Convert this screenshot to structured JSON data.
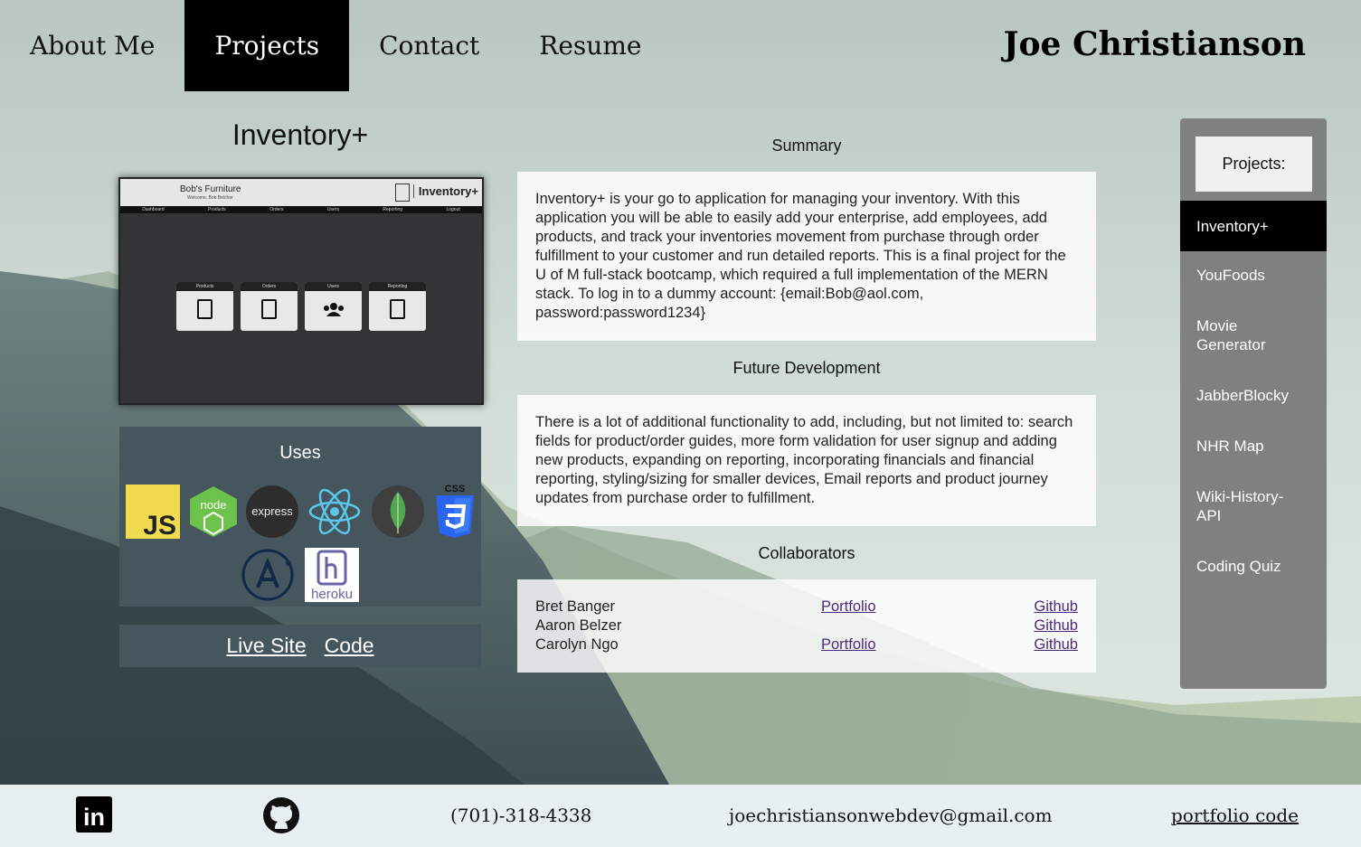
{
  "nav": {
    "items": [
      {
        "label": "About Me",
        "active": false
      },
      {
        "label": "Projects",
        "active": true
      },
      {
        "label": "Contact",
        "active": false
      },
      {
        "label": "Resume",
        "active": false
      }
    ],
    "site_title": "Joe Christianson"
  },
  "project": {
    "title": "Inventory+",
    "screenshot": {
      "company": "Bob's Furniture",
      "welcome": "Welcome, Bob Belcher",
      "brand": "Inventory+",
      "menu": [
        "Dashboard",
        "Products",
        "Orders",
        "Users",
        "Reporting",
        "Logout"
      ],
      "cards": [
        "Products",
        "Orders",
        "Users",
        "Reporting"
      ]
    },
    "uses_title": "Uses",
    "technologies": [
      "JavaScript",
      "Node.js",
      "Express",
      "React",
      "MongoDB",
      "CSS3",
      "Apollo",
      "Heroku"
    ],
    "tech_logo_text": {
      "js": "JS",
      "node": "node",
      "express": "express",
      "css": "CSS",
      "heroku": "heroku"
    },
    "links": {
      "live_site": "Live Site",
      "code": "Code"
    }
  },
  "summary": {
    "heading": "Summary",
    "text": "Inventory+ is your go to application for managing your inventory. With this application you will be able to easily add your enterprise, add employees, add products, and track your inventories movement from purchase through order fulfillment to your customer and run detailed reports. This is a final project for the U of M full-stack bootcamp, which required a full implementation of the MERN stack. To log in to a dummy account: {email:Bob@aol.com, password:password1234}"
  },
  "future": {
    "heading": "Future Development",
    "text": "There is a lot of additional functionality to add, including, but not limited to: search fields for product/order guides, more form validation for user signup and adding new products, expanding on reporting, incorporating financials and financial reporting, styling/sizing for smaller devices, Email reports and product journey updates from purchase order to fulfillment."
  },
  "collaborators": {
    "heading": "Collaborators",
    "rows": [
      {
        "name": "Bret Banger",
        "portfolio": "Portfolio",
        "github": "Github"
      },
      {
        "name": "Aaron Belzer",
        "portfolio": "",
        "github": "Github"
      },
      {
        "name": "Carolyn Ngo",
        "portfolio": "Portfolio",
        "github": "Github"
      }
    ]
  },
  "sidebar": {
    "heading": "Projects:",
    "items": [
      {
        "label": "Inventory+",
        "active": true
      },
      {
        "label": "YouFoods",
        "active": false
      },
      {
        "label": "Movie Generator",
        "active": false
      },
      {
        "label": "JabberBlocky",
        "active": false
      },
      {
        "label": "NHR Map",
        "active": false
      },
      {
        "label": "Wiki-History-API",
        "active": false
      },
      {
        "label": "Coding Quiz",
        "active": false
      }
    ]
  },
  "footer": {
    "linkedin_text": "in",
    "phone": "(701)-318-4338",
    "email": "joechristiansonwebdev@gmail.com",
    "portfolio_code": "portfolio code"
  },
  "colors": {
    "nav_active": "#000000",
    "panel_dark": "#46565e",
    "sidebar": "#7e817e",
    "footer": "#e7eff1"
  }
}
